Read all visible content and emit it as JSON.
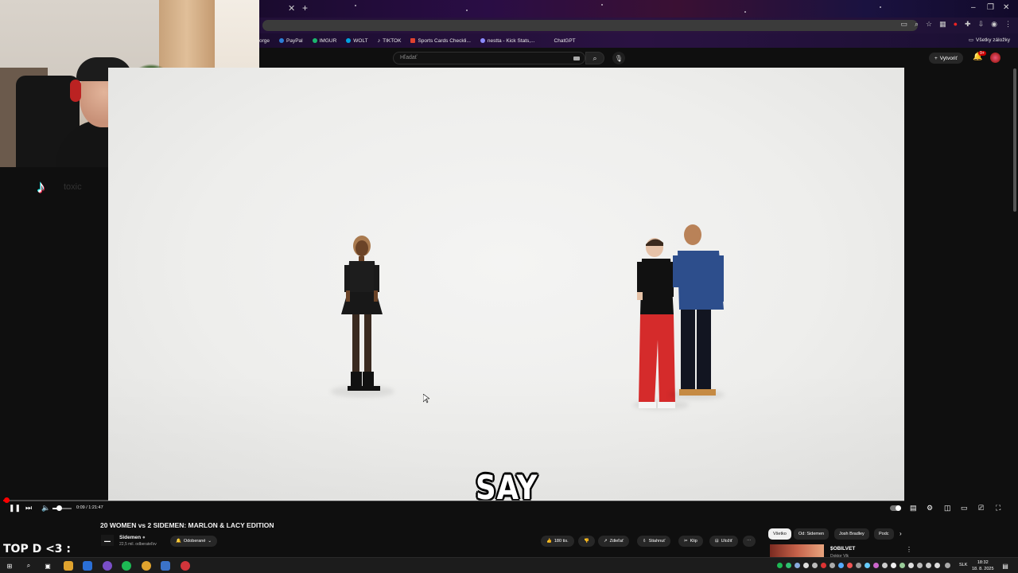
{
  "browser": {
    "bookmarks": [
      {
        "label": "orge",
        "color": "#ff7b00"
      },
      {
        "label": "PayPal",
        "color": "#2c7fd6"
      },
      {
        "label": "IMGUR",
        "color": "#1bb76e"
      },
      {
        "label": "WOLT",
        "color": "#00a3e0"
      },
      {
        "label": "TIKTOK",
        "color": "#ffffff"
      },
      {
        "label": "Sports Cards Checkli...",
        "color": "#e0422f"
      },
      {
        "label": "nestta - Kick Stats,...",
        "color": "#8b8bff"
      },
      {
        "label": "ChatGPT",
        "color": "#111111"
      }
    ],
    "all_bookmarks_label": "Všetky záložky"
  },
  "youtube": {
    "search_placeholder": "Hľadať",
    "create_label": "Vytvoriť",
    "notification_count": "9+"
  },
  "overlay": {
    "tiktok_handle": "toxic",
    "stream_label": "TOP D <3 :"
  },
  "video": {
    "caption": "SAY",
    "time_current": "0:09",
    "time_total": "1:21:47",
    "time_display": "0:09 / 1:21:47",
    "progress_fraction": 0.0018,
    "volume_fraction": 0.35
  },
  "meta": {
    "title": "20 WOMEN vs 2 SIDEMEN: MARLON & LACY EDITION",
    "channel_name": "Sidemen",
    "channel_subs": "22,5 mil. odberateľov",
    "subscribed_label": "Odoberané",
    "likes": "180 tis.",
    "share_label": "Zdieľať",
    "download_label": "Stiahnuť",
    "clip_label": "Klip",
    "save_label": "Uložiť"
  },
  "filter_chips": [
    {
      "label": "Všetko",
      "active": true
    },
    {
      "label": "Od: Sidemen",
      "active": false
    },
    {
      "label": "Josh Bradley",
      "active": false
    },
    {
      "label": "Podc",
      "active": false
    }
  ],
  "recommended": {
    "title": "$OBILVET",
    "subtitle": "Doktor Vlk"
  },
  "taskbar": {
    "language": "SLK",
    "time": "18:32",
    "date": "18. 8. 2025"
  },
  "colors": {
    "accent_red": "#ff0000",
    "background": "#0f0f0f",
    "pill": "#272727"
  }
}
